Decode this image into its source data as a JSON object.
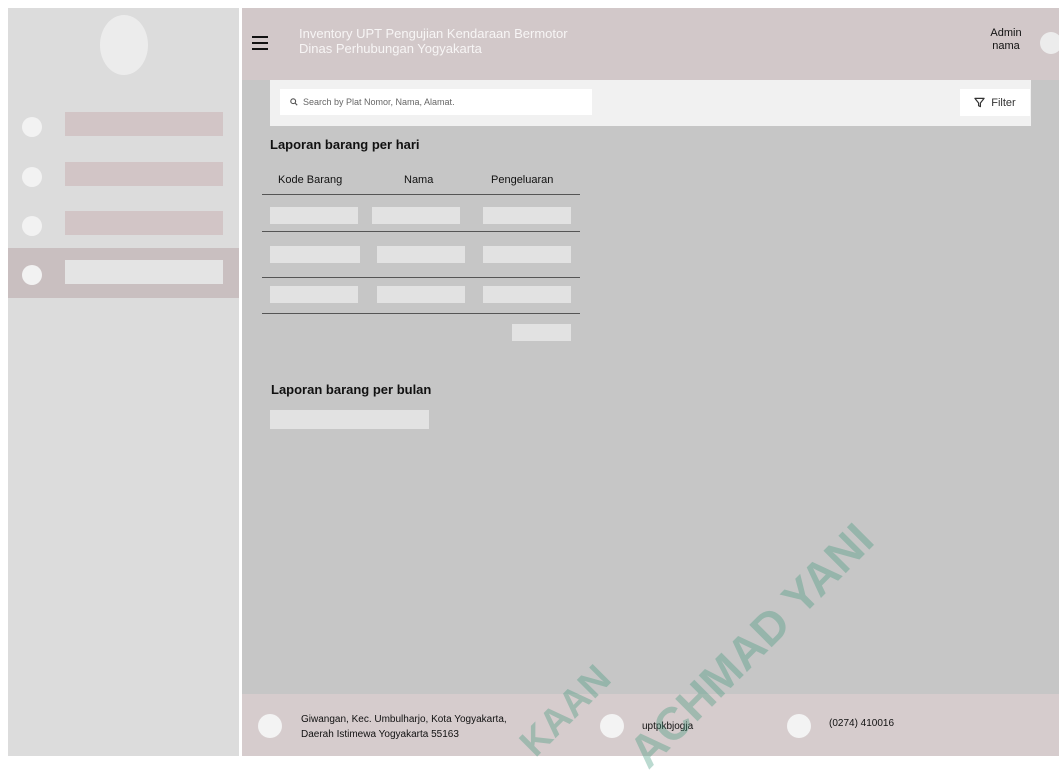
{
  "header": {
    "title_line1": "Inventory UPT Pengujian Kendaraan Bermotor",
    "title_line2": "Dinas Perhubungan Yogyakarta",
    "user_role": "Admin",
    "user_name": "nama"
  },
  "search": {
    "placeholder": "Search by Plat Nomor, Nama, Alamat.",
    "filter_label": "Filter"
  },
  "daily_report": {
    "title": "Laporan barang per hari",
    "columns": [
      "Kode Barang",
      "Nama",
      "Pengeluaran"
    ]
  },
  "monthly_report": {
    "title": "Laporan barang per bulan"
  },
  "footer": {
    "address_line1": "Giwangan, Kec. Umbulharjo, Kota Yogyakarta,",
    "address_line2": "Daerah Istimewa Yogyakarta 55163",
    "social": "uptpkbjogja",
    "phone": "(0274) 410016"
  },
  "watermark": {
    "text1": "ACHMAD YANI",
    "text2": "KAAN"
  },
  "colors": {
    "sidebar": "#dcdcdc",
    "header": "#d2c8c9",
    "main": "#c6c6c6",
    "footer": "#d6cccd",
    "watermark": "#3c9678"
  }
}
